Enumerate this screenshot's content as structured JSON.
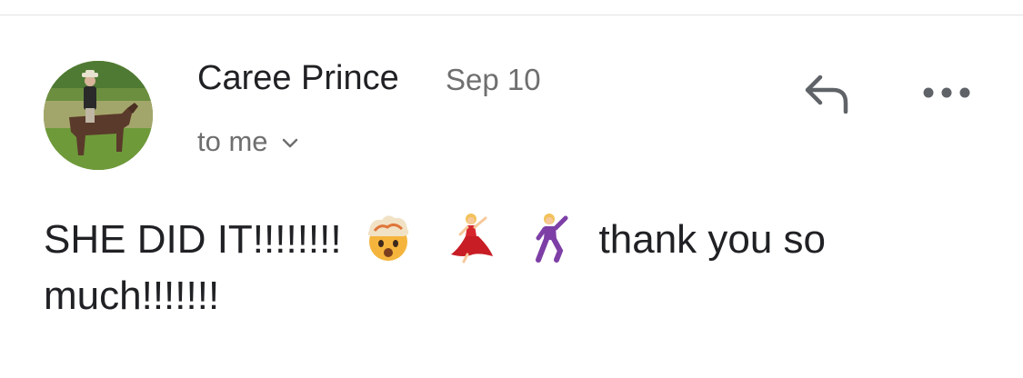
{
  "divider": true,
  "message": {
    "sender_name": "Caree Prince",
    "date": "Sep 10",
    "recipient_label": "to me",
    "avatar_icon": "avatar-photo-horse-rider",
    "text_before_emoji": "SHE DID IT!!!!!!!!",
    "emojis": [
      "exploding-head-emoji",
      "woman-dancing-emoji",
      "man-dancing-emoji"
    ],
    "text_after_emoji": "thank you so much!!!!!!!"
  },
  "actions": {
    "reply_icon": "reply-arrow-icon",
    "more_icon": "more-horizontal-icon"
  },
  "colors": {
    "primary_text": "#202124",
    "secondary_text": "#6f6f6f",
    "icon": "#5f6368",
    "divider": "#e3e3e3"
  }
}
